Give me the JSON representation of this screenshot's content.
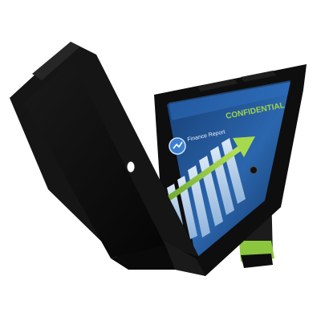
{
  "product": {
    "screen_heading": "CONFIDENTIAL",
    "screen_app_title": "Finance Report",
    "accent_color": "#8cc63f",
    "case_color": "#111111",
    "screen_bg_color": "#1f4f8f"
  }
}
